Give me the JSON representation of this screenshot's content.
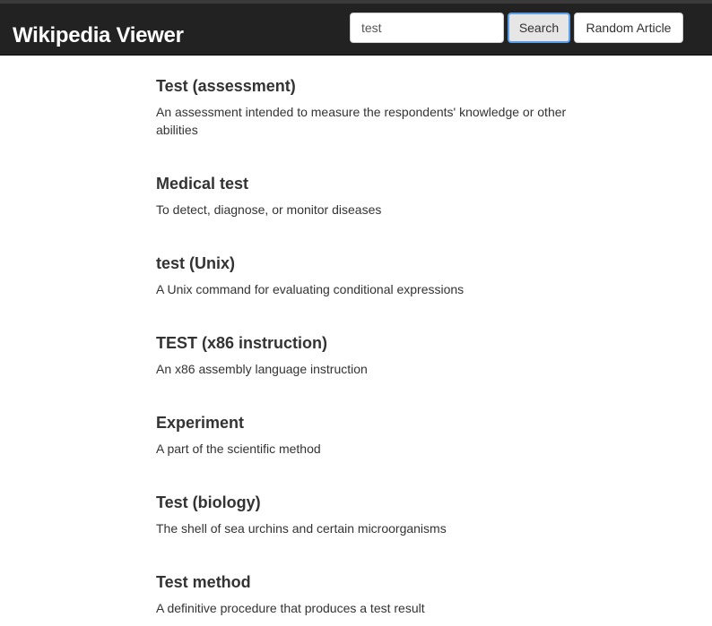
{
  "navbar": {
    "brand": "Wikipedia Viewer",
    "search_value": "test",
    "search_button": "Search",
    "random_button": "Random Article"
  },
  "results": [
    {
      "title": "Test (assessment)",
      "description": "An assessment intended to measure the respondents' knowledge or other abilities"
    },
    {
      "title": "Medical test",
      "description": "To detect, diagnose, or monitor diseases"
    },
    {
      "title": "test (Unix)",
      "description": "A Unix command for evaluating conditional expressions"
    },
    {
      "title": "TEST (x86 instruction)",
      "description": "An x86 assembly language instruction"
    },
    {
      "title": "Experiment",
      "description": "A part of the scientific method"
    },
    {
      "title": "Test (biology)",
      "description": "The shell of sea urchins and certain microorganisms"
    },
    {
      "title": "Test method",
      "description": "A definitive procedure that produces a test result"
    }
  ]
}
